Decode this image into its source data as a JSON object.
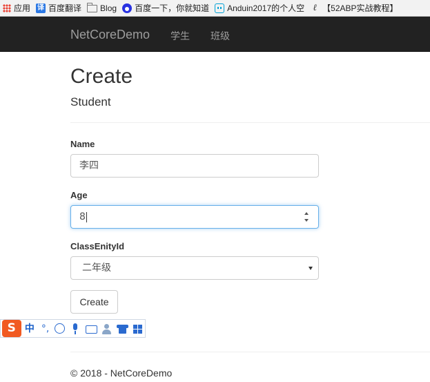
{
  "bookmarks": [
    {
      "icon": "apps-icon",
      "label": "应用"
    },
    {
      "icon": "fanyi-icon",
      "icon_text": "译",
      "label": "百度翻译"
    },
    {
      "icon": "folder-icon",
      "label": "Blog"
    },
    {
      "icon": "baidu-paw-icon",
      "label": "百度一下，你就知道"
    },
    {
      "icon": "bilibili-icon",
      "label": "Anduin2017的个人空"
    },
    {
      "icon": "abp-icon",
      "icon_text": "ℓ",
      "label": "【52ABP实战教程】"
    }
  ],
  "navbar": {
    "brand": "NetCoreDemo",
    "links": [
      "学生",
      "班级"
    ],
    "background": "#222222",
    "link_color": "#9d9d9d"
  },
  "page": {
    "title": "Create",
    "subtitle": "Student"
  },
  "form": {
    "name": {
      "label": "Name",
      "value": "李四"
    },
    "age": {
      "label": "Age",
      "value": "8"
    },
    "class": {
      "label": "ClassEnityId",
      "selected": "二年级"
    },
    "submit": "Create",
    "focus_color": "#66afe9"
  },
  "ime": {
    "logo": "S",
    "items": [
      {
        "icon": "chinese-mode-icon",
        "text": "中"
      },
      {
        "icon": "punctuation-icon",
        "text": "°,"
      },
      {
        "icon": "emoji-icon"
      },
      {
        "icon": "microphone-icon"
      },
      {
        "icon": "keyboard-icon"
      },
      {
        "icon": "user-icon"
      },
      {
        "icon": "skin-shirt-icon"
      },
      {
        "icon": "toolbox-grid-icon"
      }
    ],
    "logo_color": "#f15a22"
  },
  "footer": {
    "text": "© 2018 - NetCoreDemo"
  }
}
